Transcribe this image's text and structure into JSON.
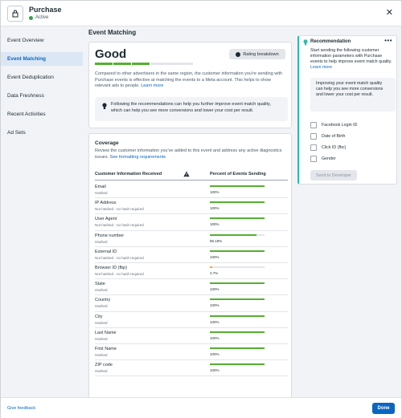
{
  "header": {
    "title": "Purchase",
    "status": "Active"
  },
  "sidebar": {
    "items": [
      {
        "label": "Event Overview"
      },
      {
        "label": "Event Matching"
      },
      {
        "label": "Event Deduplication"
      },
      {
        "label": "Data Freshness"
      },
      {
        "label": "Recent Activities"
      },
      {
        "label": "Ad Sets"
      }
    ]
  },
  "main": {
    "title": "Event Matching",
    "rating": "Good",
    "rating_button": "Rating breakdown",
    "description": "Compared to other advertisers in the same region, the customer information you're sending with Purchase events is effective at matching the events to a Meta account. This helps to show relevant ads to people.",
    "learn_more": "Learn more",
    "tip": "Following the recommendations can help you further improve event match quality, which can help you see more conversions and lower your cost per result.",
    "coverage": {
      "title": "Coverage",
      "description": "Review the customer information you've added to this event and address any active diagnostics issues.",
      "link": "See formatting requirements",
      "col1": "Customer Information Received",
      "col2": "Percent of Events Sending",
      "rows": [
        {
          "name": "Email",
          "sub": "Hashed",
          "pct": "100%",
          "value": 100
        },
        {
          "name": "IP Address",
          "sub": "Not hashed - no hash required",
          "pct": "100%",
          "value": 100
        },
        {
          "name": "User Agent",
          "sub": "Not hashed - no hash required",
          "pct": "100%",
          "value": 100
        },
        {
          "name": "Phone number",
          "sub": "Hashed",
          "pct": "85.19%",
          "value": 85.19
        },
        {
          "name": "External ID",
          "sub": "Not hashed - no hash required",
          "pct": "100%",
          "value": 100
        },
        {
          "name": "Browser ID (fbp)",
          "sub": "Not hashed - no hash required",
          "pct": "3.7%",
          "value": 3.7
        },
        {
          "name": "State",
          "sub": "Hashed",
          "pct": "100%",
          "value": 100
        },
        {
          "name": "Country",
          "sub": "Hashed",
          "pct": "100%",
          "value": 100
        },
        {
          "name": "City",
          "sub": "Hashed",
          "pct": "100%",
          "value": 100
        },
        {
          "name": "Last Name",
          "sub": "Hashed",
          "pct": "100%",
          "value": 100
        },
        {
          "name": "First Name",
          "sub": "Hashed",
          "pct": "100%",
          "value": 100
        },
        {
          "name": "ZIP code",
          "sub": "Hashed",
          "pct": "100%",
          "value": 100
        }
      ]
    }
  },
  "recommendation": {
    "title": "Recommendation",
    "description": "Start sending the following customer information parameters with Purchase events to help improve event match quality.",
    "learn_more": "Learn more",
    "box": "Improving your event match quality can help you see more conversions and lower your cost per result.",
    "params": [
      "Facebook Login ID",
      "Date of Birth",
      "Click ID (fbc)",
      "Gender"
    ],
    "send_button": "Send to Developer"
  },
  "footer": {
    "feedback": "Give feedback",
    "done": "Done"
  },
  "colors": {
    "accent": "#0a66c2",
    "good_green": "#54b030",
    "teal": "#2abba7",
    "low_orange": "#f5a623"
  },
  "rating_level": {
    "filled_segments": 3,
    "total_segments": 4
  }
}
